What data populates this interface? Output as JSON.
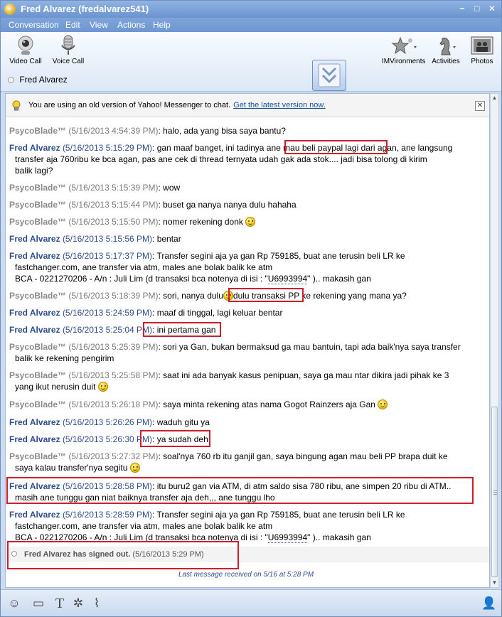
{
  "window": {
    "title": "Fred Alvarez (fredalvarez541)",
    "controls": {
      "minimize": "−",
      "maximize": "□",
      "close": "✕"
    }
  },
  "menu": [
    "Conversation",
    "Edit",
    "View",
    "Actions",
    "Help"
  ],
  "toolbar": {
    "video_call": "Video Call",
    "voice_call": "Voice Call",
    "imvironments": "IMVironments",
    "activities": "Activities",
    "photos": "Photos",
    "contact_name": "Fred Alvarez"
  },
  "notice": {
    "text": "You are using an old version of Yahoo! Messenger to chat.",
    "link": "Get the latest version now."
  },
  "messages": [
    {
      "sender": "PsycoBlade™",
      "time": "(5/16/2013 4:54:39 PM)",
      "text": "halo, ada yang bisa saya bantu?"
    },
    {
      "sender": "Fred Alvarez",
      "time": "(5/16/2013 5:15:29 PM)",
      "pre": "gan maaf banget, ini tadinya ane ",
      "hl": "mau beli paypal lagi dari",
      "post": " agan, ane langsung",
      "cont": "transfer aja 760ribu ke bca agan, pas ane cek di thread ternyata udah gak ada stok.... jadi bisa tolong di kirim",
      "cont2": "balik lagi?"
    },
    {
      "sender": "PsycoBlade™",
      "time": "(5/16/2013 5:15:39 PM)",
      "text": "wow"
    },
    {
      "sender": "PsycoBlade™",
      "time": "(5/16/2013 5:15:44 PM)",
      "text": "buset ga nanya nanya dulu hahaha"
    },
    {
      "sender": "PsycoBlade™",
      "time": "(5/16/2013 5:15:50 PM)",
      "text": "nomer rekening donk"
    },
    {
      "sender": "Fred Alvarez",
      "time": "(5/16/2013 5:15:56 PM)",
      "text": "bentar"
    },
    {
      "sender": "Fred Alvarez",
      "time": "(5/16/2013 5:17:37 PM)",
      "text": "Transfer segini aja ya gan Rp 759185, buat ane terusin beli LR ke",
      "cont": "fastchanger.com, ane transfer via atm, males ane bolak balik ke atm",
      "cont2a": "BCA - 0221270206 - A/n : Juli Lim  (d transaksi bca notenya di isi : \"",
      "code": "U6993994",
      "cont2b": "\" ).. makasih gan"
    },
    {
      "sender": "PsycoBlade™",
      "time": "(5/16/2013 5:18:39 PM)",
      "pre": "sori, nanya dulu",
      "hl": "dulu transaksi PP",
      "post": " ke rekening yang mana ya?"
    },
    {
      "sender": "Fred Alvarez",
      "time": "(5/16/2013 5:24:59 PM)",
      "text": "maaf di tinggal, lagi keluar bentar"
    },
    {
      "sender": "Fred Alvarez",
      "time": "(5/16/2013 5:25:04 PM)",
      "text": "ini pertama gan"
    },
    {
      "sender": "PsycoBlade™",
      "time": "(5/16/2013 5:25:39 PM)",
      "text": "sori ya Gan, bukan bermaksud ga mau bantuin, tapi ada baik'nya saya transfer",
      "cont": "balik ke rekening pengirim"
    },
    {
      "sender": "PsycoBlade™",
      "time": "(5/16/2013 5:25:58 PM)",
      "text": "saat ini ada banyak kasus penipuan, saya ga mau ntar dikira jadi pihak ke 3",
      "cont": "yang ikut nerusin duit"
    },
    {
      "sender": "PsycoBlade™",
      "time": "(5/16/2013 5:26:18 PM)",
      "text": "saya minta rekening atas nama Gogot Rainzers aja Gan"
    },
    {
      "sender": "Fred Alvarez",
      "time": "(5/16/2013 5:26:26 PM)",
      "text": "waduh gitu ya"
    },
    {
      "sender": "Fred Alvarez",
      "time": "(5/16/2013 5:26:30 PM)",
      "text": "ya sudah deh"
    },
    {
      "sender": "PsycoBlade™",
      "time": "(5/16/2013 5:27:32 PM)",
      "text": "soal'nya 760 rb itu ganjil gan, saya bingung agan mau beli PP brapa duit ke",
      "cont": "saya kalau transfer'nya segitu"
    },
    {
      "sender": "Fred Alvarez",
      "time": "(5/16/2013 5:28:58 PM)",
      "text": "itu buru2 gan via ATM, di atm saldo sisa 780 ribu, ane simpen 20 ribu di ATM..",
      "cont": "masih ane tunggu gan niat baiknya transfer aja deh,,, ane tunggu lho"
    },
    {
      "sender": "Fred Alvarez",
      "time": "(5/16/2013 5:28:59 PM)",
      "text": "Transfer segini aja ya gan Rp 759185, buat ane terusin beli LR ke",
      "cont": "fastchanger.com, ane transfer via atm, males ane bolak balik ke atm",
      "cont2a": "BCA - 0221270206 - A/n : Juli Lim  (d transaksi bca notenya di isi : \"",
      "code": "U6993994",
      "cont2b": "\" ).. makasih gan"
    }
  ],
  "signout": {
    "text": "Fred Alvarez has signed out.",
    "time": "(5/16/2013 5:29 PM)"
  },
  "last_message": "Last message received on 5/16 at 5:28 PM",
  "colors": {
    "highlight_box": "#cc1f2a",
    "fred": "#2f4e8f",
    "psyco": "#8a8a8a"
  }
}
